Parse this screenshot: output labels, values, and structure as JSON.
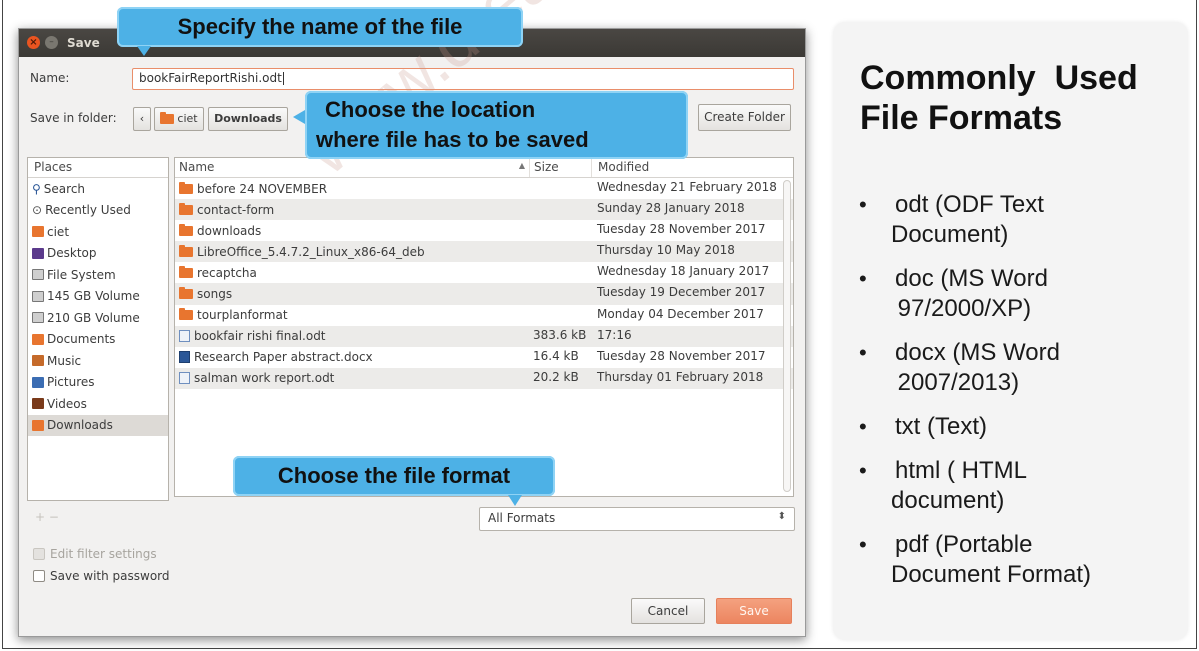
{
  "dialog": {
    "title": "Save",
    "name_label": "Name:",
    "file_name": "bookFairReportRishi.odt",
    "folder_label": "Save in folder:",
    "path": [
      "ciet",
      "Downloads"
    ],
    "create_folder": "Create Folder",
    "places_header": "Places",
    "places": [
      {
        "label": "Search",
        "icon": "search-icon"
      },
      {
        "label": "Recently Used",
        "icon": "clock-icon"
      },
      {
        "label": "ciet",
        "icon": "home-folder-icon"
      },
      {
        "label": "Desktop",
        "icon": "desktop-icon"
      },
      {
        "label": "File System",
        "icon": "drive-icon"
      },
      {
        "label": "145 GB Volume",
        "icon": "drive-icon"
      },
      {
        "label": "210 GB Volume",
        "icon": "drive-icon"
      },
      {
        "label": "Documents",
        "icon": "documents-folder-icon"
      },
      {
        "label": "Music",
        "icon": "music-folder-icon"
      },
      {
        "label": "Pictures",
        "icon": "pictures-folder-icon"
      },
      {
        "label": "Videos",
        "icon": "videos-folder-icon"
      },
      {
        "label": "Downloads",
        "icon": "downloads-folder-icon"
      }
    ],
    "columns": {
      "name": "Name",
      "size": "Size",
      "modified": "Modified"
    },
    "files": [
      {
        "name": "before 24 NOVEMBER",
        "size": "",
        "modified": "Wednesday 21 February 2018",
        "type": "folder"
      },
      {
        "name": "contact-form",
        "size": "",
        "modified": "Sunday 28 January 2018",
        "type": "folder"
      },
      {
        "name": "downloads",
        "size": "",
        "modified": "Tuesday 28 November 2017",
        "type": "folder"
      },
      {
        "name": "LibreOffice_5.4.7.2_Linux_x86-64_deb",
        "size": "",
        "modified": "Thursday 10 May 2018",
        "type": "folder"
      },
      {
        "name": "recaptcha",
        "size": "",
        "modified": "Wednesday 18 January 2017",
        "type": "folder"
      },
      {
        "name": "songs",
        "size": "",
        "modified": "Tuesday 19 December 2017",
        "type": "folder"
      },
      {
        "name": "tourplanformat",
        "size": "",
        "modified": "Monday 04 December 2017",
        "type": "folder"
      },
      {
        "name": "bookfair rishi final.odt",
        "size": "383.6 kB",
        "modified": "17:16",
        "type": "odt"
      },
      {
        "name": "Research Paper abstract.docx",
        "size": "16.4 kB",
        "modified": "Tuesday 28 November 2017",
        "type": "docx"
      },
      {
        "name": "salman work report.odt",
        "size": "20.2 kB",
        "modified": "Thursday 01 February 2018",
        "type": "odt"
      }
    ],
    "format_selected": "All Formats",
    "add_remove": "+ −",
    "edit_filter": "Edit filter settings",
    "save_password": "Save with password",
    "cancel": "Cancel",
    "save": "Save"
  },
  "callouts": {
    "name": "Specify the name of the file",
    "location_line1": "Choose the location",
    "location_line2": "where file has to be saved",
    "format": "Choose the file format"
  },
  "watermark": "www.dreamtopper",
  "side": {
    "title_line1": "Commonly  Used",
    "title_line2": "File Formats",
    "formats": [
      {
        "line1": "odt (ODF Text",
        "line2": "Document)"
      },
      {
        "line1": "doc (MS Word",
        "line2": " 97/2000/XP)"
      },
      {
        "line1": "docx (MS Word",
        "line2": " 2007/2013)"
      },
      {
        "line1": "txt (Text)",
        "line2": ""
      },
      {
        "line1": "html ( HTML",
        "line2": "document)"
      },
      {
        "line1": "pdf (Portable",
        "line2": "Document Format)"
      }
    ]
  },
  "colors": {
    "callout": "#4db1e6",
    "accent_orange": "#e95420",
    "save_button": "#ec8560"
  }
}
